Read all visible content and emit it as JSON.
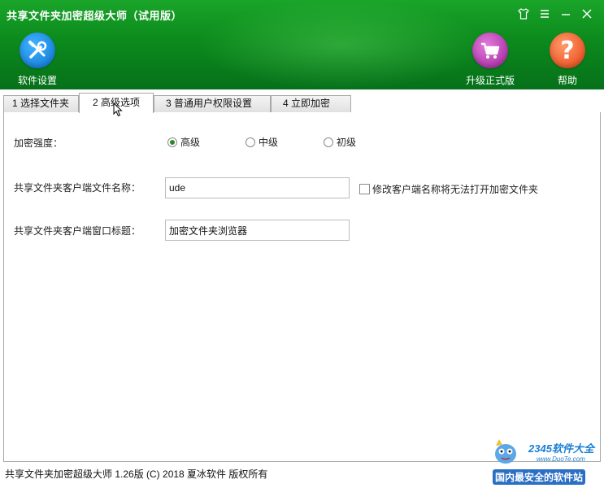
{
  "window": {
    "title": "共享文件夹加密超级大师（试用版）",
    "controls": [
      "skin-icon",
      "menu-icon",
      "minimize-icon",
      "close-icon"
    ]
  },
  "toolbar": {
    "settings_label": "软件设置",
    "upgrade_label": "升级正式版",
    "help_label": "帮助",
    "help_glyph": "?"
  },
  "tabs": [
    {
      "label": "1 选择文件夹",
      "active": false
    },
    {
      "label": "2 高级选项",
      "active": true
    },
    {
      "label": "3 普通用户权限设置",
      "active": false
    },
    {
      "label": "4 立即加密",
      "active": false
    }
  ],
  "form": {
    "strength_label": "加密强度：",
    "strength_options": [
      {
        "label": "高级",
        "selected": true
      },
      {
        "label": "中级",
        "selected": false
      },
      {
        "label": "初级",
        "selected": false
      }
    ],
    "client_name_label": "共享文件夹客户端文件名称：",
    "client_name_value": "ude",
    "rename_warning_label": "修改客户端名称将无法打开加密文件夹",
    "rename_warning_checked": false,
    "window_title_label": "共享文件夹客户端窗口标题：",
    "window_title_value": "加密文件夹浏览器"
  },
  "status_bar": {
    "text": "共享文件夹加密超级大师 1.26版 (C) 2018 夏冰软件 版权所有"
  },
  "watermark": {
    "brand": "2345软件大全",
    "url": "www.DuoTe.com",
    "slogan": "国内最安全的软件站"
  },
  "colors": {
    "header_green": "#0c8a1c",
    "settings_blue": "#1c86e0",
    "upgrade_purple": "#b33aae",
    "help_orange": "#ee5a2b",
    "radio_selected": "#2a8a2a"
  }
}
